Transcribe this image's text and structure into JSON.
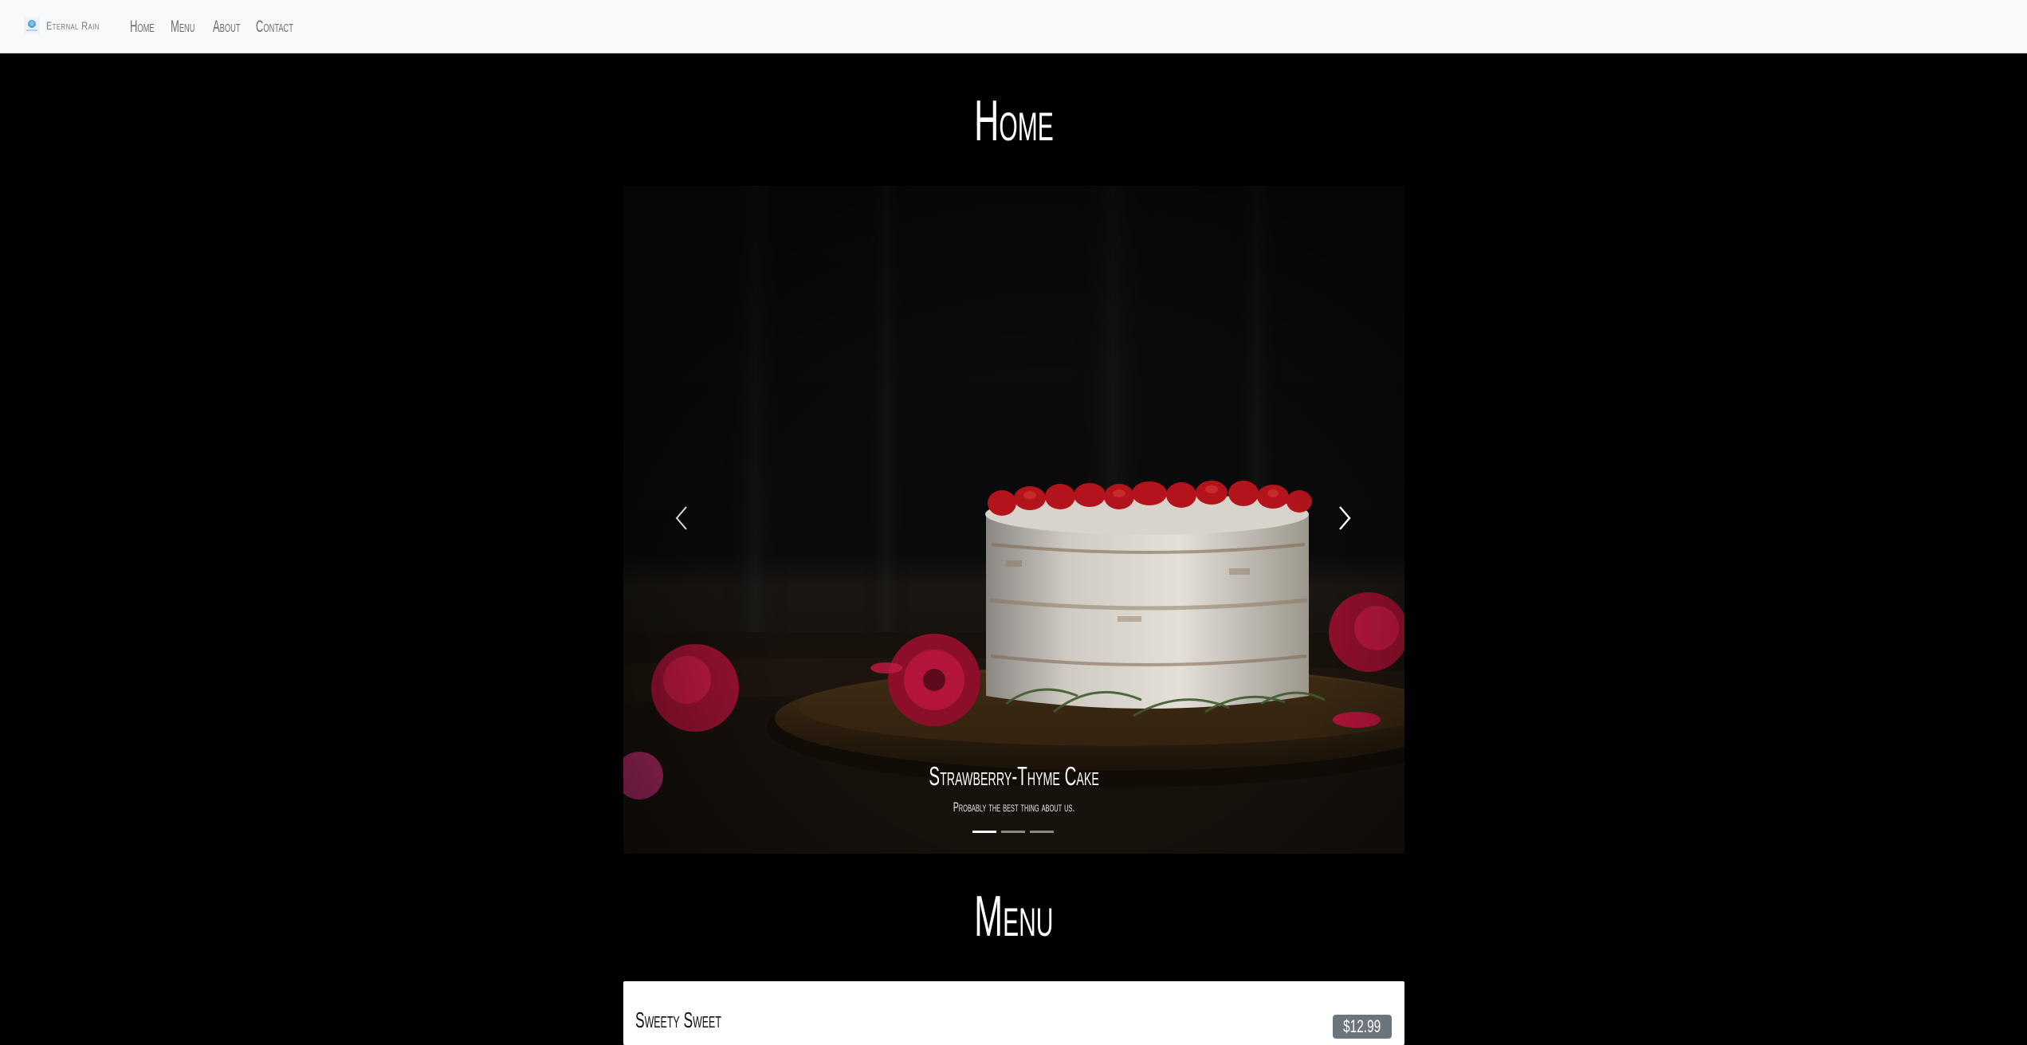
{
  "navbar": {
    "brand": "Eternal Rain",
    "links": [
      "Home",
      "Menu",
      "About",
      "Contact"
    ]
  },
  "home": {
    "title": "Home"
  },
  "carousel": {
    "slides": [
      {
        "title": "Strawberry-Thyme Cake",
        "subtitle": "Probably the best thing about us.",
        "image": "photo of a naked layer cake topped with strawberries on a wooden board with red flowers and thyme"
      }
    ],
    "active_index": 0,
    "indicator_count": 3,
    "prev_icon": "chevron-left-icon",
    "next_icon": "chevron-right-icon"
  },
  "menu": {
    "title": "Menu",
    "items": [
      {
        "name": "Sweety Sweet",
        "price": "$12.99"
      }
    ]
  },
  "colors": {
    "navbar_bg": "#f8f9fa",
    "page_bg": "#000000",
    "badge_bg": "#6c757d",
    "text_light": "#ffffff"
  }
}
